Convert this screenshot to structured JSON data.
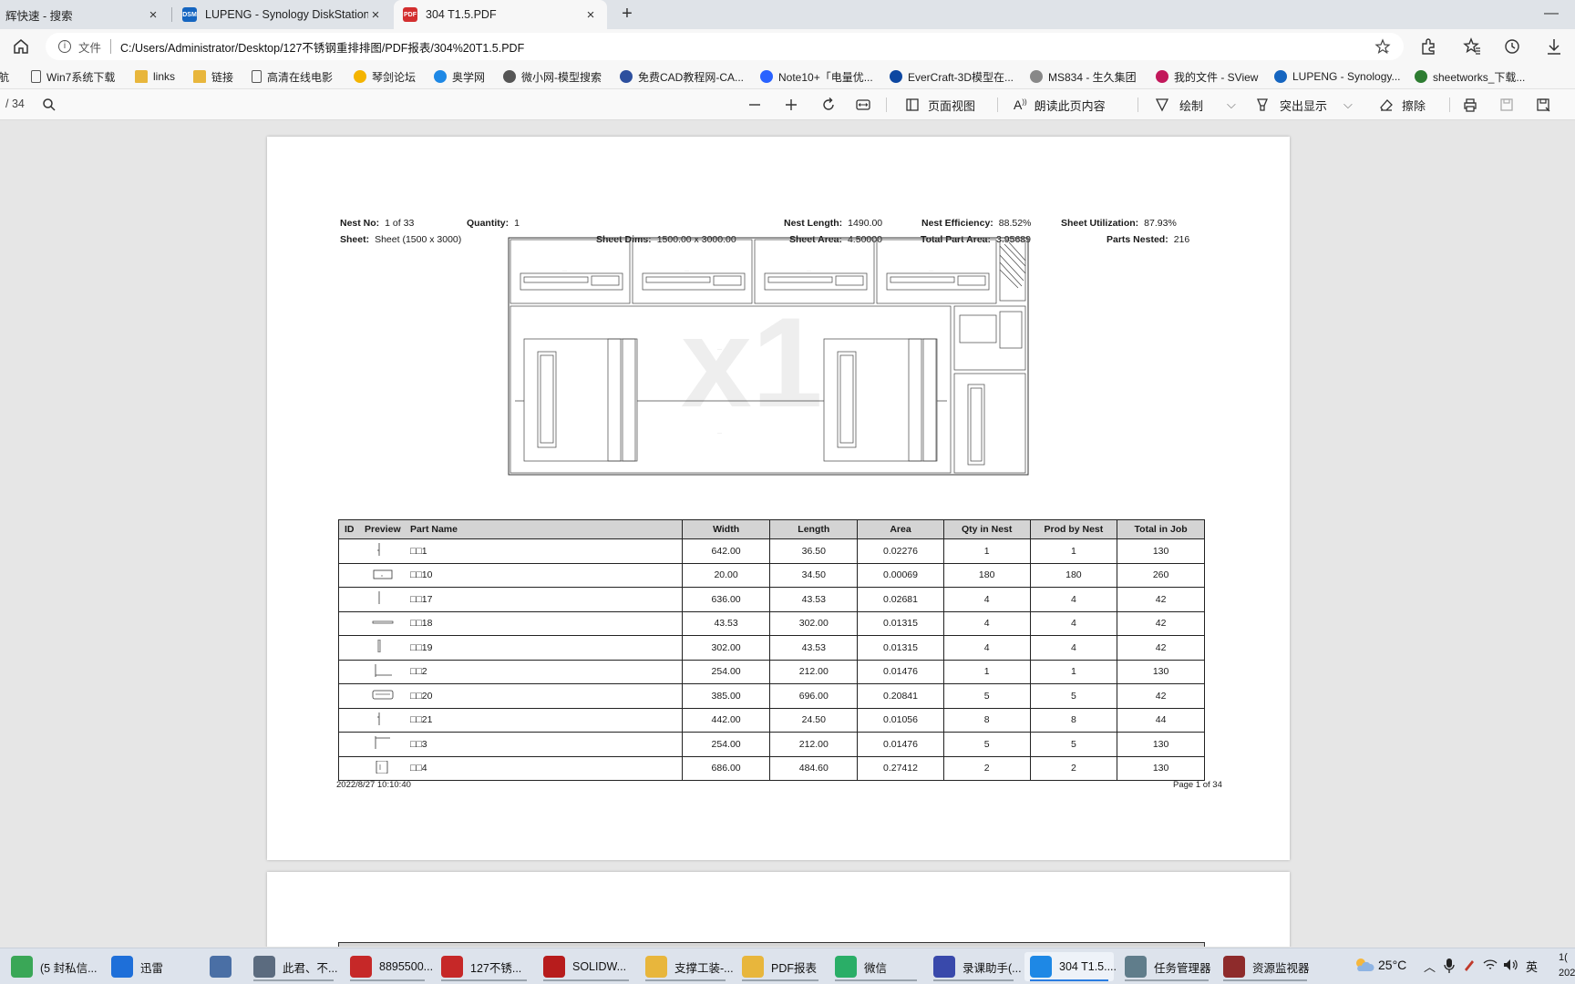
{
  "tabs": [
    {
      "title": "辉快速 - 搜索",
      "active": false
    },
    {
      "title": "LUPENG - Synology DiskStation",
      "active": false,
      "icon_text": "DSM"
    },
    {
      "title": "304 T1.5.PDF",
      "active": true
    }
  ],
  "address": {
    "label": "文件",
    "url": "C:/Users/Administrator/Desktop/127不锈钢重排排图/PDF报表/304%20T1.5.PDF"
  },
  "bookmarks": [
    {
      "label": "航",
      "icon": "page",
      "color": "#666666"
    },
    {
      "label": "Win7系统下载",
      "icon": "page",
      "color": "#555555"
    },
    {
      "label": "links",
      "icon": "folder",
      "color": "#e8b63c"
    },
    {
      "label": "链接",
      "icon": "folder",
      "color": "#e8b63c"
    },
    {
      "label": "高清在线电影",
      "icon": "page",
      "color": "#555555"
    },
    {
      "label": "琴剑论坛",
      "icon": "fav",
      "color": "#f4b400"
    },
    {
      "label": "奥学网",
      "icon": "fav",
      "color": "#1e88e5"
    },
    {
      "label": "微小网-模型搜索",
      "icon": "fav",
      "color": "#555555"
    },
    {
      "label": "免费CAD教程网-CA...",
      "icon": "fav",
      "color": "#2d4f9e"
    },
    {
      "label": "Note10+「电量优...",
      "icon": "fav",
      "color": "#2962ff"
    },
    {
      "label": "EverCraft-3D模型在...",
      "icon": "fav",
      "color": "#0d47a1"
    },
    {
      "label": "MS834 - 生久集团",
      "icon": "fav",
      "color": "#888888"
    },
    {
      "label": "我的文件 - SView",
      "icon": "fav",
      "color": "#c2185b"
    },
    {
      "label": "LUPENG - Synology...",
      "icon": "fav",
      "color": "#1565c0"
    },
    {
      "label": "sheetworks_下载...",
      "icon": "fav",
      "color": "#2e7d32"
    }
  ],
  "pdf_toolbar": {
    "page_count": "/ 34",
    "page_view": "页面视图",
    "read_aloud": "朗读此页内容",
    "draw": "绘制",
    "highlight": "突出显示",
    "erase": "擦除"
  },
  "report": {
    "nest_no_label": "Nest No:",
    "nest_no": "1 of 33",
    "quantity_label": "Quantity:",
    "quantity": "1",
    "nest_length_label": "Nest Length:",
    "nest_length": "1490.00",
    "nest_eff_label": "Nest Efficiency:",
    "nest_eff": "88.52%",
    "sheet_util_label": "Sheet Utilization:",
    "sheet_util": "87.93%",
    "sheet_label": "Sheet:",
    "sheet": "Sheet (1500 x 3000)",
    "sheet_dims_label": "Sheet Dims:",
    "sheet_dims": "1500.00 x 3000.00",
    "sheet_area_label": "Sheet Area:",
    "sheet_area": "4.50000",
    "total_area_label": "Total Part Area:",
    "total_area": "3.95689",
    "parts_nested_label": "Parts Nested:",
    "parts_nested": "216",
    "watermark": "x1",
    "columns": [
      "ID",
      "Preview",
      "Part Name",
      "Width",
      "Length",
      "Area",
      "Qty in Nest",
      "Prod by Nest",
      "Total in Job"
    ],
    "rows": [
      {
        "name": "□□1",
        "width": "642.00",
        "length": "36.50",
        "area": "0.02276",
        "qty": "1",
        "prod": "1",
        "total": "130"
      },
      {
        "name": "□□10",
        "width": "20.00",
        "length": "34.50",
        "area": "0.00069",
        "qty": "180",
        "prod": "180",
        "total": "260"
      },
      {
        "name": "□□17",
        "width": "636.00",
        "length": "43.53",
        "area": "0.02681",
        "qty": "4",
        "prod": "4",
        "total": "42"
      },
      {
        "name": "□□18",
        "width": "43.53",
        "length": "302.00",
        "area": "0.01315",
        "qty": "4",
        "prod": "4",
        "total": "42"
      },
      {
        "name": "□□19",
        "width": "302.00",
        "length": "43.53",
        "area": "0.01315",
        "qty": "4",
        "prod": "4",
        "total": "42"
      },
      {
        "name": "□□2",
        "width": "254.00",
        "length": "212.00",
        "area": "0.01476",
        "qty": "1",
        "prod": "1",
        "total": "130"
      },
      {
        "name": "□□20",
        "width": "385.00",
        "length": "696.00",
        "area": "0.20841",
        "qty": "5",
        "prod": "5",
        "total": "42"
      },
      {
        "name": "□□21",
        "width": "442.00",
        "length": "24.50",
        "area": "0.01056",
        "qty": "8",
        "prod": "8",
        "total": "44"
      },
      {
        "name": "□□3",
        "width": "254.00",
        "length": "212.00",
        "area": "0.01476",
        "qty": "5",
        "prod": "5",
        "total": "130"
      },
      {
        "name": "□□4",
        "width": "686.00",
        "length": "484.60",
        "area": "0.27412",
        "qty": "2",
        "prod": "2",
        "total": "130"
      }
    ],
    "date": "2022/8/27 10:10:40",
    "page_info": "Page 1 of 34"
  },
  "taskbar": [
    {
      "label": "(5 封私信...",
      "color": "#3aa757"
    },
    {
      "label": "迅雷",
      "color": "#1e6fd9"
    },
    {
      "label": "",
      "color": "#4a6fa5"
    },
    {
      "label": "此君、不...",
      "color": "#5b6b7f"
    },
    {
      "label": "8895500...",
      "color": "#c62828"
    },
    {
      "label": "127不锈...",
      "color": "#c62828"
    },
    {
      "label": "SOLIDW...",
      "color": "#b71c1c"
    },
    {
      "label": "支撑工装-...",
      "color": "#e8b63c"
    },
    {
      "label": "PDF报表",
      "color": "#e8b63c"
    },
    {
      "label": "微信",
      "color": "#2aae67"
    },
    {
      "label": "录课助手(...",
      "color": "#3949ab"
    },
    {
      "label": "304 T1.5....",
      "color": "#1e88e5",
      "active": true
    },
    {
      "label": "任务管理器",
      "color": "#607d8b"
    },
    {
      "label": "资源监视器",
      "color": "#8e2b2b"
    }
  ],
  "tray": {
    "temp": "25°C",
    "ime": "英",
    "clock_top": "1(",
    "clock_bottom": "202"
  }
}
